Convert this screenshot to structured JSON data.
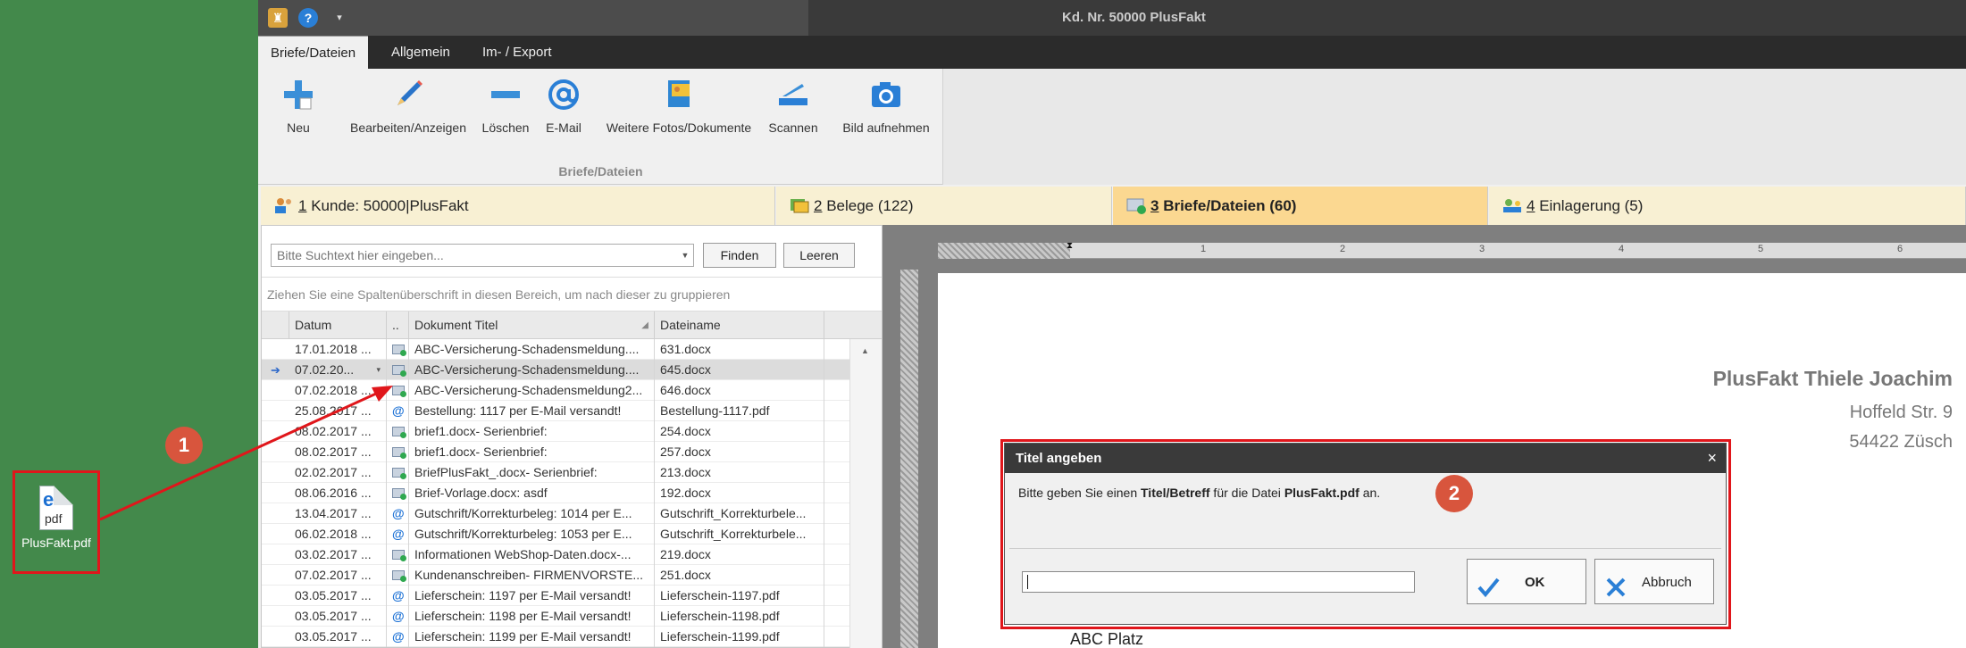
{
  "desktop": {
    "icon_label": "PlusFakt.pdf",
    "icon_type": "pdf",
    "icon_glyph": "e"
  },
  "window": {
    "title": "Kd. Nr. 50000 PlusFakt",
    "quick_help": "?",
    "quick_drop": "▾"
  },
  "menu": {
    "tabs": [
      "Briefe/Dateien",
      "Allgemein",
      "Im- / Export"
    ]
  },
  "ribbon": {
    "buttons": [
      "Neu",
      "Bearbeiten/Anzeigen",
      "Löschen",
      "E-Mail",
      "Weitere Fotos/Dokumente",
      "Scannen",
      "Bild aufnehmen"
    ],
    "group_label": "Briefe/Dateien"
  },
  "main_tabs": [
    {
      "number": "1",
      "label": " Kunde: 50000|PlusFakt"
    },
    {
      "number": "2",
      "label": " Belege (122)"
    },
    {
      "number": "3",
      "label": " Briefe/Dateien (60)"
    },
    {
      "number": "4",
      "label": " Einlagerung (5)"
    }
  ],
  "search": {
    "placeholder": "Bitte Suchtext hier eingeben...",
    "find_label": "Finden",
    "clear_label": "Leeren"
  },
  "grid": {
    "group_hint": "Ziehen Sie eine Spaltenüberschrift in diesen Bereich, um nach dieser zu gruppieren",
    "columns": [
      "Datum",
      "..",
      "Dokument Titel",
      "Dateiname"
    ],
    "rows": [
      {
        "date": "17.01.2018 ...",
        "type": "mail",
        "title": "ABC-Versicherung-Schadensmeldung....",
        "file": "631.docx"
      },
      {
        "date": "07.02.20...",
        "type": "mail",
        "title": "ABC-Versicherung-Schadensmeldung....",
        "file": "645.docx"
      },
      {
        "date": "07.02.2018 ...",
        "type": "mail",
        "title": "ABC-Versicherung-Schadensmeldung2...",
        "file": "646.docx"
      },
      {
        "date": "25.08.2017 ...",
        "type": "at",
        "title": "Bestellung: 1117 per E-Mail versandt!",
        "file": "Bestellung-1117.pdf"
      },
      {
        "date": "08.02.2017 ...",
        "type": "mail",
        "title": "brief1.docx- Serienbrief:",
        "file": "254.docx"
      },
      {
        "date": "08.02.2017 ...",
        "type": "mail",
        "title": "brief1.docx- Serienbrief:",
        "file": "257.docx"
      },
      {
        "date": "02.02.2017 ...",
        "type": "mail",
        "title": "BriefPlusFakt_.docx- Serienbrief:",
        "file": "213.docx"
      },
      {
        "date": "08.06.2016 ...",
        "type": "mail",
        "title": "Brief-Vorlage.docx: asdf",
        "file": "192.docx"
      },
      {
        "date": "13.04.2017 ...",
        "type": "at",
        "title": "Gutschrift/Korrekturbeleg: 1014 per E...",
        "file": "Gutschrift_Korrekturbele..."
      },
      {
        "date": "06.02.2018 ...",
        "type": "at",
        "title": "Gutschrift/Korrekturbeleg: 1053 per E...",
        "file": "Gutschrift_Korrekturbele..."
      },
      {
        "date": "03.02.2017 ...",
        "type": "mail",
        "title": "Informationen WebShop-Daten.docx-...",
        "file": "219.docx"
      },
      {
        "date": "07.02.2017 ...",
        "type": "mail",
        "title": "Kundenanschreiben- FIRMENVORSTE...",
        "file": "251.docx"
      },
      {
        "date": "03.05.2017 ...",
        "type": "at",
        "title": "Lieferschein: 1197 per E-Mail versandt!",
        "file": "Lieferschein-1197.pdf"
      },
      {
        "date": "03.05.2017 ...",
        "type": "at",
        "title": "Lieferschein: 1198 per E-Mail versandt!",
        "file": "Lieferschein-1198.pdf"
      },
      {
        "date": "03.05.2017 ...",
        "type": "at",
        "title": "Lieferschein: 1199 per E-Mail versandt!",
        "file": "Lieferschein-1199.pdf"
      }
    ],
    "selected_row_indicator": "➔",
    "selected_row_dropdown": "▾",
    "scroll_up": "▲"
  },
  "preview": {
    "sender_name": "PlusFakt Thiele Joachim",
    "sender_street": "Hoffeld Str. 9",
    "sender_city": "54422 Züsch",
    "bottom_text": "ABC Platz",
    "ruler_numbers": [
      "1",
      "2",
      "3",
      "4",
      "5",
      "6"
    ]
  },
  "dialog": {
    "title": "Titel angeben",
    "close": "×",
    "msg_pre": "Bitte geben Sie einen ",
    "msg_bold1": "Titel/Betreff",
    "msg_mid": " für die Datei ",
    "msg_bold2": "PlusFakt.pdf",
    "msg_post": " an.",
    "input_value": "",
    "ok_label": "OK",
    "cancel_label": "Abbruch"
  },
  "annotations": {
    "badge1": "1",
    "badge2": "2"
  },
  "colors": {
    "desktop": "#43894b",
    "highlight": "#e0161b",
    "badge": "#d8553d",
    "active_tab": "#fbd891",
    "tab": "#f8f0d3"
  }
}
